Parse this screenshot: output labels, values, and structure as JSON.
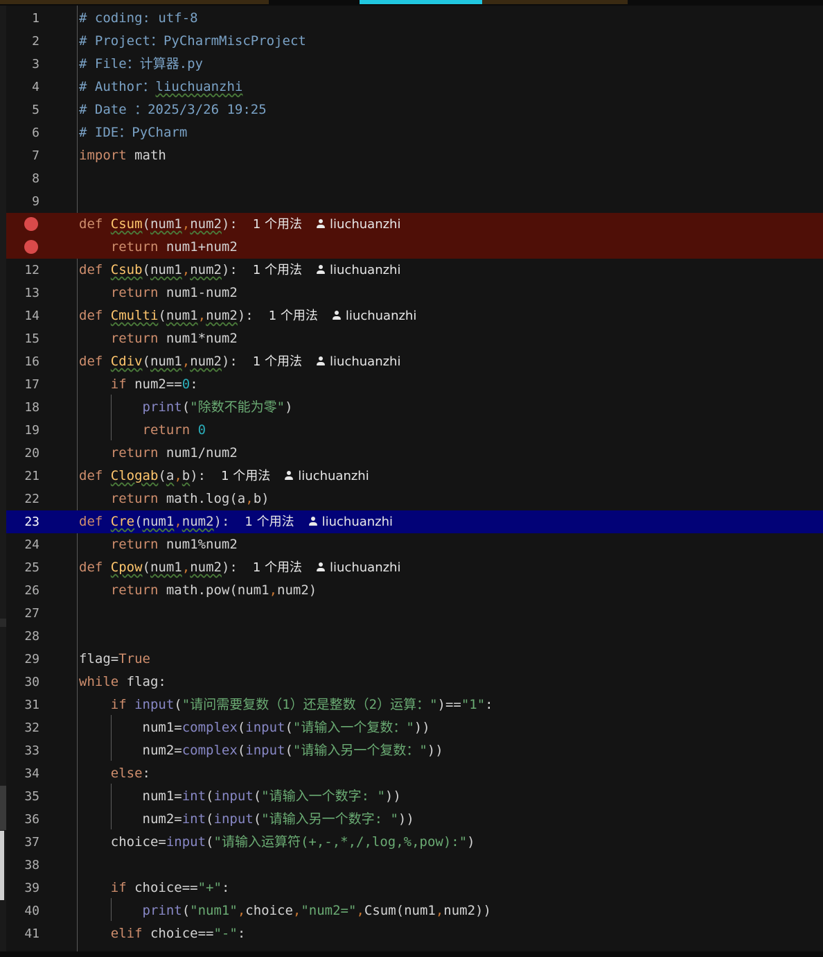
{
  "editor": {
    "usage_hint": "1 个用法",
    "author_hint": "liuchuanzhi",
    "colors": {
      "background": "#141414",
      "breakpoint_line": "#4f0f07",
      "current_line": "#020277",
      "keyword": "#cf8e6d",
      "string": "#6aab73",
      "comment": "#7aa2c6",
      "function_def": "#ffc66d",
      "number": "#2aacb8",
      "builtin": "#8888c6"
    },
    "lines": [
      {
        "n": "1",
        "t": "# coding: utf-8"
      },
      {
        "n": "2",
        "t": "# Project：PyCharmMiscProject"
      },
      {
        "n": "3",
        "t": "# File：计算器.py"
      },
      {
        "n": "4",
        "t": "# Author：",
        "a": "liuchuanzhi"
      },
      {
        "n": "5",
        "t": "# Date ：2025/3/26 19:25"
      },
      {
        "n": "6",
        "t": "# IDE：PyCharm"
      },
      {
        "n": "7",
        "k1": "import",
        "t": " math"
      },
      {
        "n": "8"
      },
      {
        "n": "9"
      },
      {
        "n": "10",
        "fn": "Csum",
        "args": [
          "num1",
          "num2"
        ]
      },
      {
        "n": "11",
        "ret": "num1+num2"
      },
      {
        "n": "12",
        "fn": "Csub",
        "args": [
          "num1",
          "num2"
        ]
      },
      {
        "n": "13",
        "ret": "num1-num2"
      },
      {
        "n": "14",
        "fn": "Cmulti",
        "args": [
          "num1",
          "num2"
        ]
      },
      {
        "n": "15",
        "ret": "num1*num2"
      },
      {
        "n": "16",
        "fn": "Cdiv",
        "args": [
          "num1",
          "num2"
        ]
      },
      {
        "n": "17",
        "if_cond": "num2==",
        "if_num": "0"
      },
      {
        "n": "18",
        "print_str": "\"除数不能为零\""
      },
      {
        "n": "19",
        "ret_num": "0"
      },
      {
        "n": "20",
        "ret": "num1/num2"
      },
      {
        "n": "21",
        "fn": "Clogab",
        "args": [
          "a",
          "b"
        ]
      },
      {
        "n": "22",
        "ret": "math.log(a,b)"
      },
      {
        "n": "23",
        "fn": "Cre",
        "args": [
          "num1",
          "num2"
        ]
      },
      {
        "n": "24",
        "ret": "num1%num2"
      },
      {
        "n": "25",
        "fn": "Cpow",
        "args": [
          "num1",
          "num2"
        ]
      },
      {
        "n": "26",
        "ret": "math.pow(num1,num2)"
      },
      {
        "n": "27"
      },
      {
        "n": "28"
      },
      {
        "n": "29",
        "t": "flag=",
        "kw": "True"
      },
      {
        "n": "30",
        "k1": "while",
        "t": " flag:"
      },
      {
        "n": "31",
        "prompt": "\"请问需要复数（1）还是整数（2）运算：\"",
        "cmp": "\"1\""
      },
      {
        "n": "32",
        "var": "num1=",
        "conv": "complex",
        "prompt": "\"请输入一个复数：\""
      },
      {
        "n": "33",
        "var": "num2=",
        "conv": "complex",
        "prompt": "\"请输入另一个复数：\""
      },
      {
        "n": "34",
        "k1": "else",
        "t": ":"
      },
      {
        "n": "35",
        "var": "num1=",
        "conv": "int",
        "prompt": "\"请输入一个数字: \""
      },
      {
        "n": "36",
        "var": "num2=",
        "conv": "int",
        "prompt": "\"请输入另一个数字: \""
      },
      {
        "n": "37",
        "var": "choice=",
        "prompt": "\"请输入运算符(+,-,*,/,log,%,pow):\""
      },
      {
        "n": "38"
      },
      {
        "n": "39",
        "k1": "if",
        "t": " choice==",
        "str": "\"+\"",
        "end": ":"
      },
      {
        "n": "40",
        "s1": "\"num1\"",
        "mid": "choice",
        "s2": "\"num2=\"",
        "call": "Csum(num1",
        "call2": "num2))"
      },
      {
        "n": "41",
        "k1": "elif",
        "t": " choice==",
        "str": "\"-\"",
        "end": ":"
      }
    ]
  }
}
